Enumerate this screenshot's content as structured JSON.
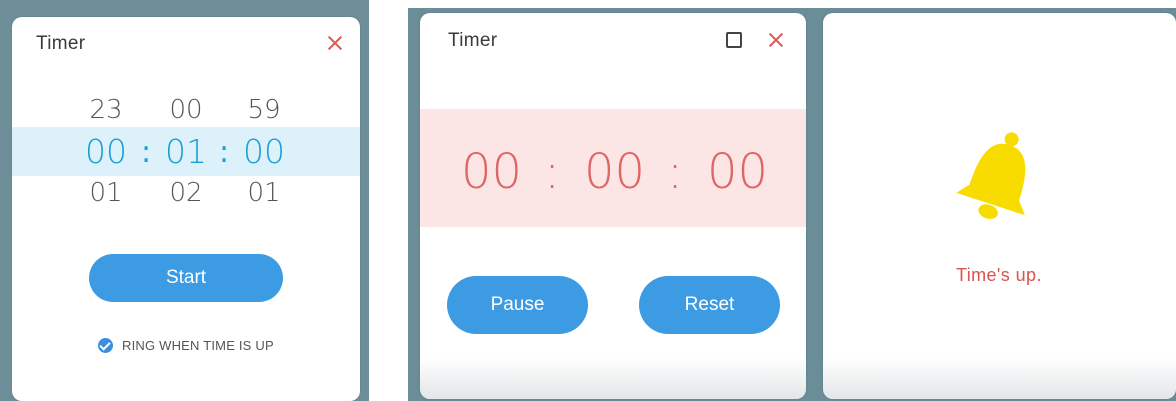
{
  "panel1": {
    "title": "Timer",
    "picker": {
      "above": [
        "23",
        "00",
        "59"
      ],
      "selected": [
        "00",
        "01",
        "00"
      ],
      "below": [
        "01",
        "02",
        "01"
      ],
      "separator": ":"
    },
    "start_label": "Start",
    "ring_label": "RING WHEN TIME IS UP",
    "ring_checked": true
  },
  "panel2": {
    "title": "Timer",
    "countdown": [
      "00",
      "00",
      "00"
    ],
    "separator": ":",
    "pause_label": "Pause",
    "reset_label": "Reset"
  },
  "panel3": {
    "message": "Time's up."
  },
  "colors": {
    "accent": "#3d9be3",
    "selected_text": "#1aa0d6",
    "alert_text": "#e06565",
    "bell": "#f8dc00"
  },
  "icons": [
    "close-icon",
    "maximize-icon",
    "check-icon",
    "bell-icon"
  ]
}
